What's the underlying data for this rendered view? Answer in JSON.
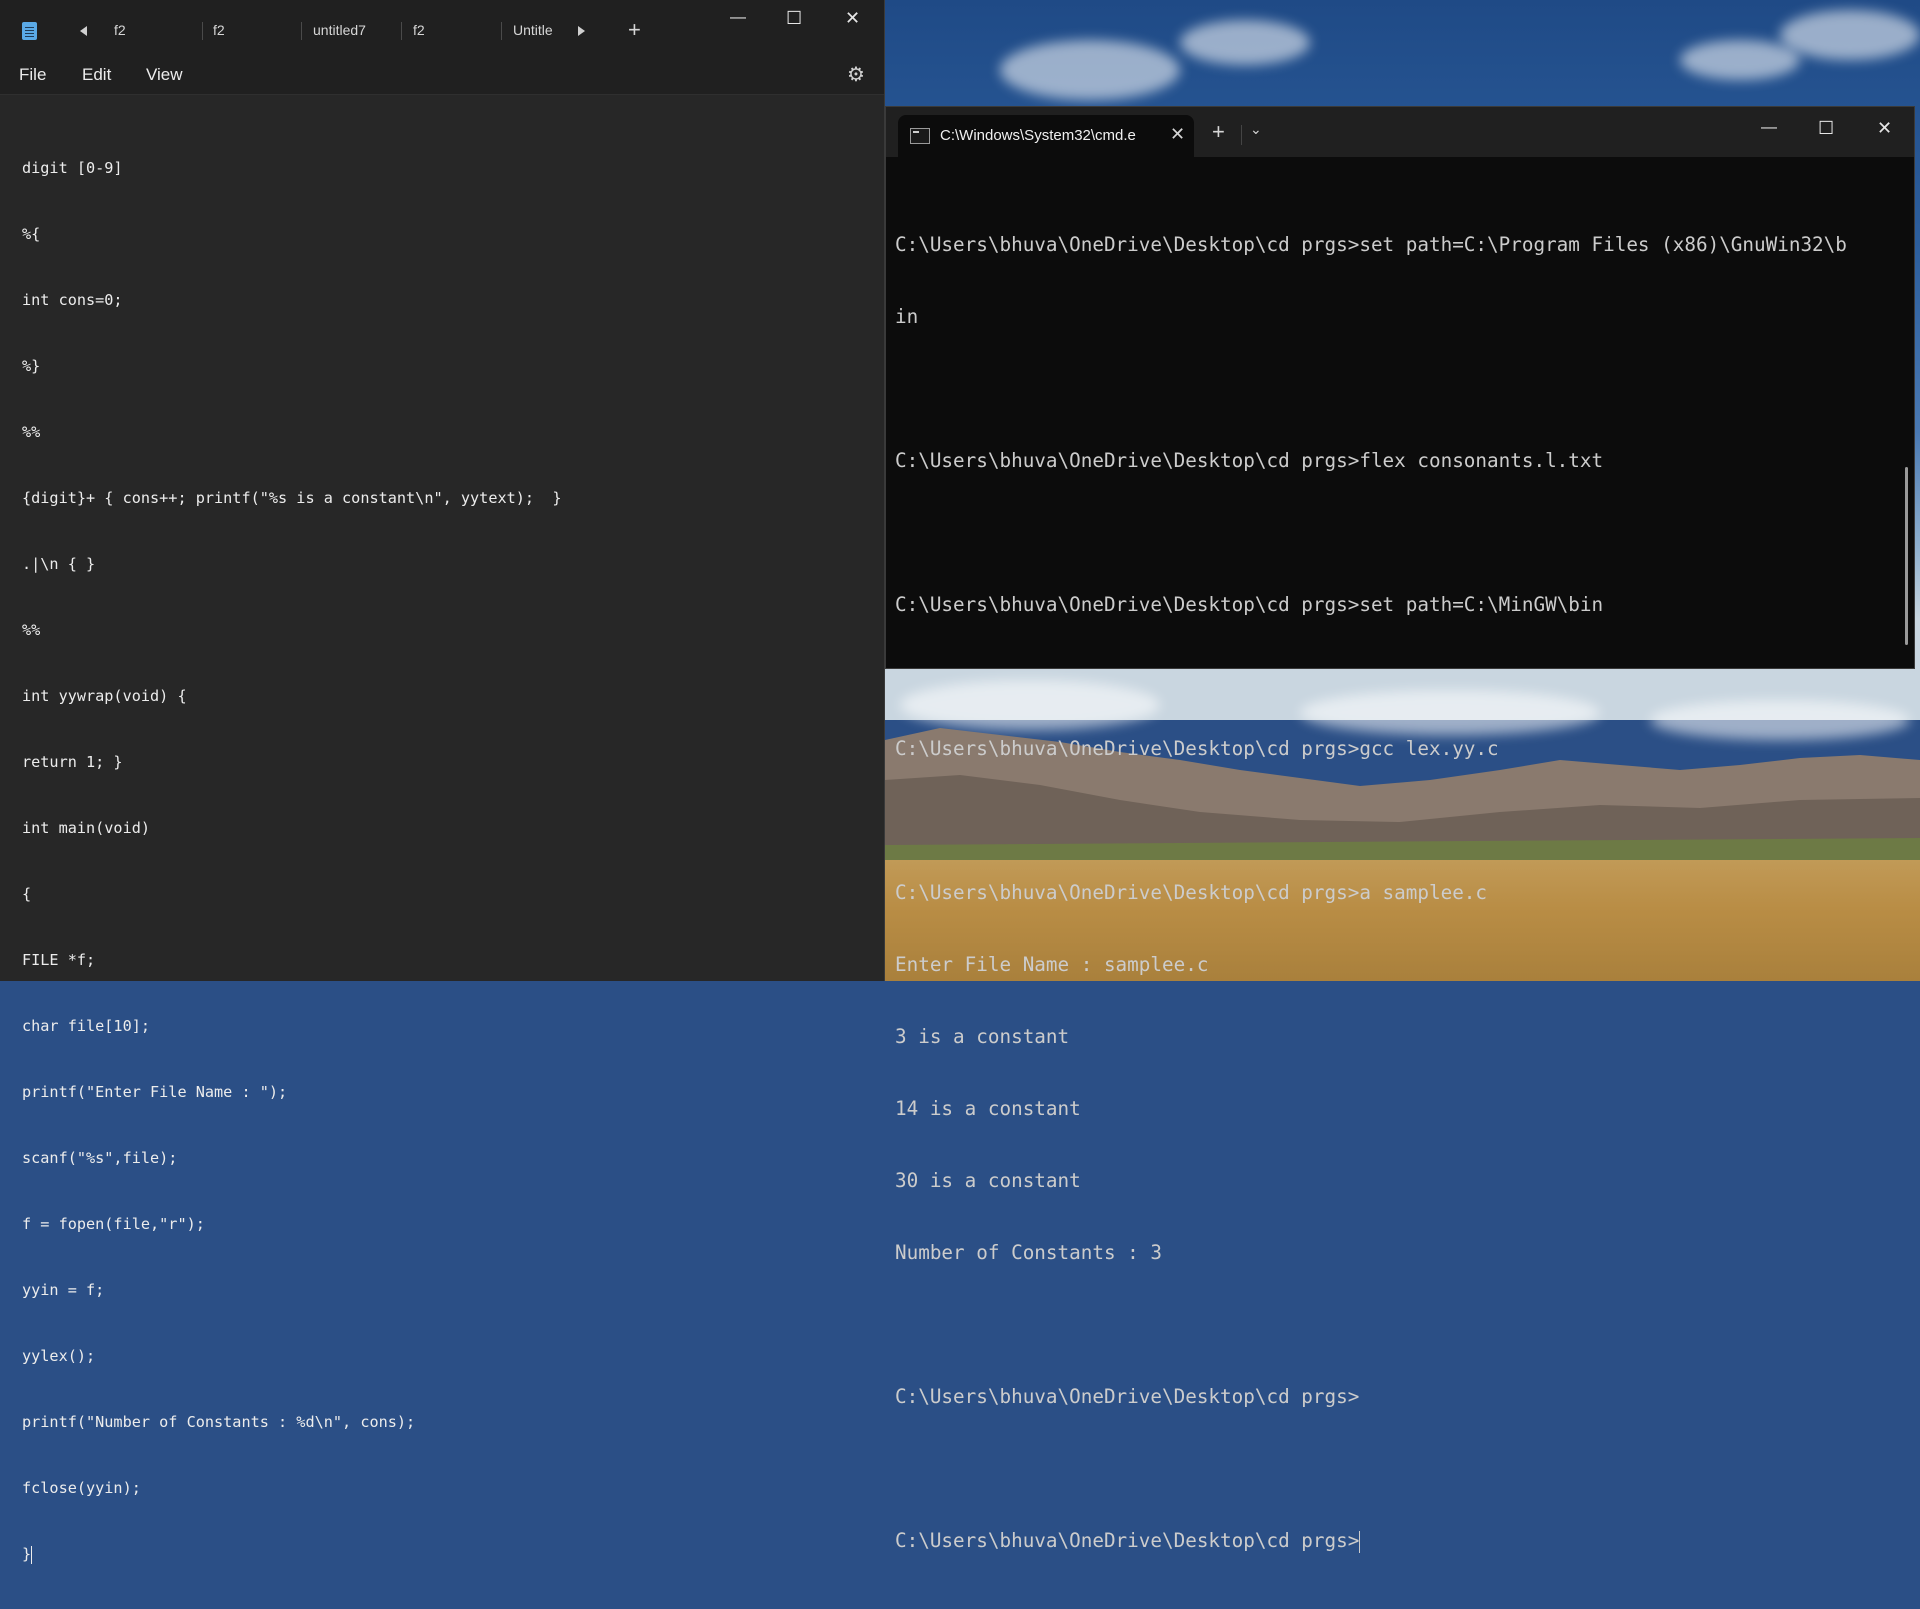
{
  "notepad": {
    "app_icon": "notepad-icon",
    "tabs": [
      "f2",
      "f2",
      "untitled7",
      "f2",
      "Untitle"
    ],
    "new_tab_label": "+",
    "menu": [
      "File",
      "Edit",
      "View"
    ],
    "settings_icon": "gear-icon",
    "window_controls": {
      "minimize": "—",
      "maximize": "☐",
      "close": "✕"
    },
    "code_lines": [
      "digit [0-9]",
      "%{",
      "int cons=0;",
      "%}",
      "%%",
      "{digit}+ { cons++; printf(\"%s is a constant\\n\", yytext);  }",
      ".|\\n { }",
      "%%",
      "int yywrap(void) {",
      "return 1; }",
      "int main(void)",
      "{",
      "FILE *f;",
      "char file[10];",
      "printf(\"Enter File Name : \");",
      "scanf(\"%s\",file);",
      "f = fopen(file,\"r\");",
      "yyin = f;",
      "yylex();",
      "printf(\"Number of Constants : %d\\n\", cons);",
      "fclose(yyin);",
      "}"
    ]
  },
  "cmd": {
    "tab_icon": "terminal-icon",
    "tab_title": "C:\\Windows\\System32\\cmd.e",
    "tab_close": "✕",
    "new_tab_label": "+",
    "dropdown": "⌄",
    "window_controls": {
      "minimize": "—",
      "maximize": "☐",
      "close": "✕"
    },
    "lines": [
      "C:\\Users\\bhuva\\OneDrive\\Desktop\\cd prgs>set path=C:\\Program Files (x86)\\GnuWin32\\b",
      "in",
      "",
      "C:\\Users\\bhuva\\OneDrive\\Desktop\\cd prgs>flex consonants.l.txt",
      "",
      "C:\\Users\\bhuva\\OneDrive\\Desktop\\cd prgs>set path=C:\\MinGW\\bin",
      "",
      "C:\\Users\\bhuva\\OneDrive\\Desktop\\cd prgs>gcc lex.yy.c",
      "",
      "C:\\Users\\bhuva\\OneDrive\\Desktop\\cd prgs>a samplee.c",
      "Enter File Name : samplee.c",
      "3 is a constant",
      "14 is a constant",
      "30 is a constant",
      "Number of Constants : 3",
      "",
      "C:\\Users\\bhuva\\OneDrive\\Desktop\\cd prgs>",
      "",
      "C:\\Users\\bhuva\\OneDrive\\Desktop\\cd prgs>"
    ]
  }
}
